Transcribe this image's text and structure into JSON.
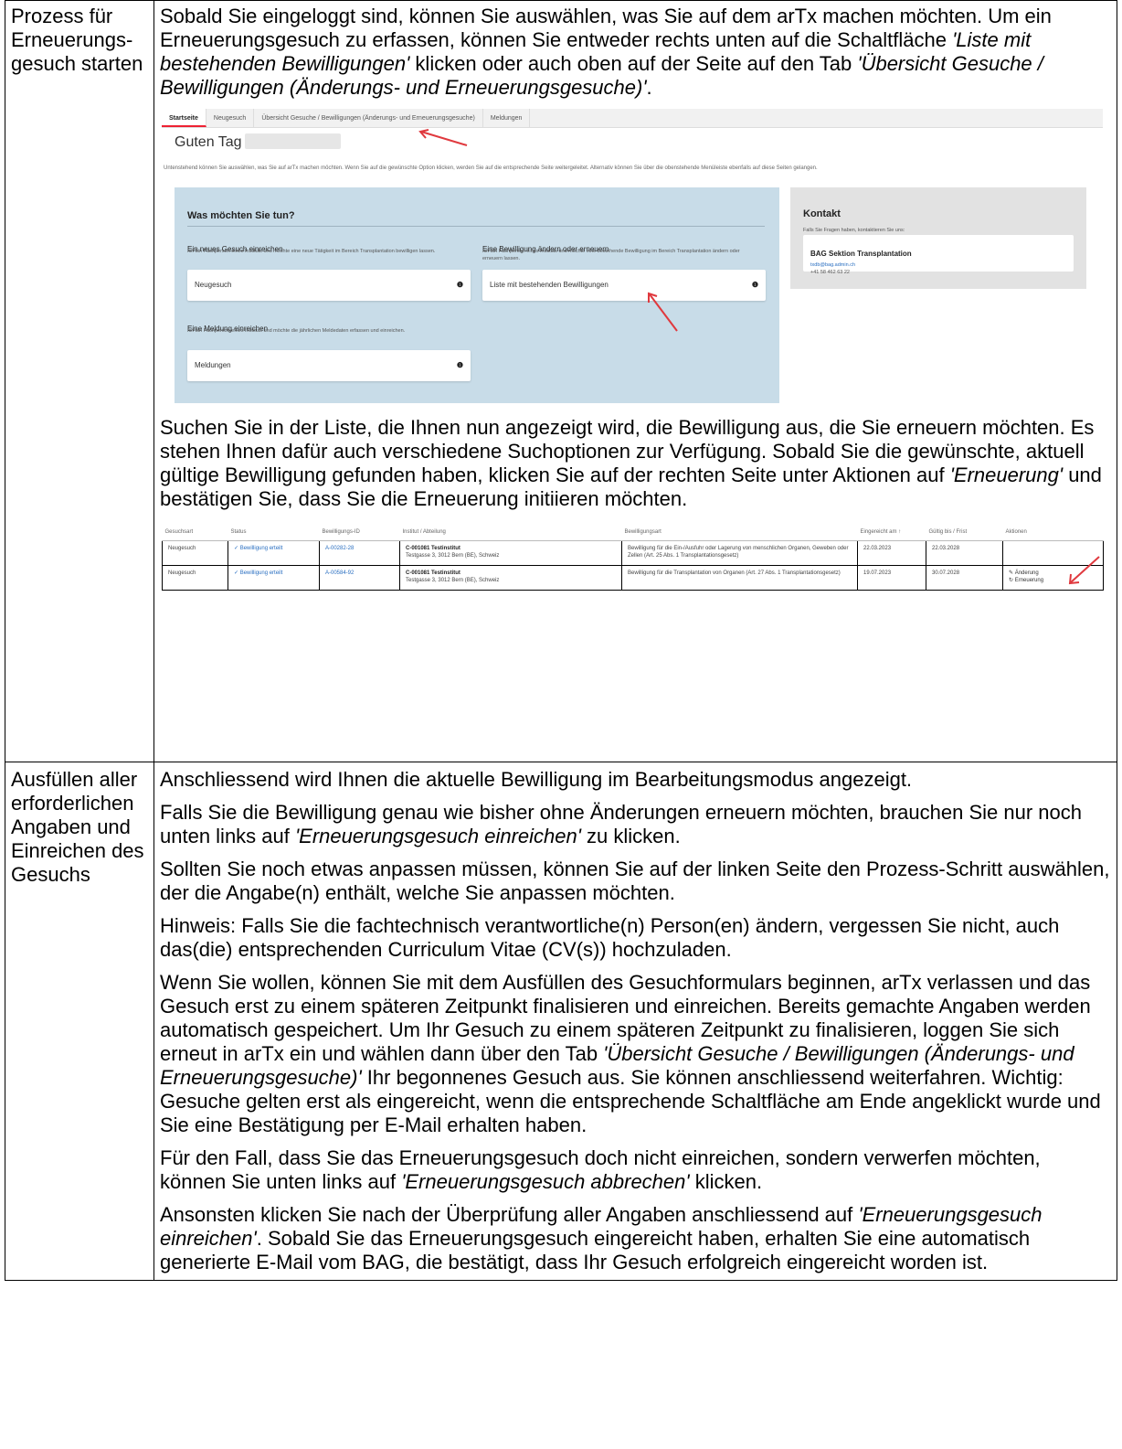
{
  "row1": {
    "label": "Prozess für Erneuerungs-gesuch starten",
    "p1_before": "Sobald Sie eingeloggt sind, können Sie auswählen, was Sie auf dem arTx machen möchten. Um ein Erneuerungsgesuch zu erfassen, können Sie entweder rechts unten auf die Schaltfläche ",
    "p1_em1": "'Liste mit bestehenden Bewilligungen'",
    "p1_mid": " klicken oder auch oben auf der Seite auf den Tab ",
    "p1_em2": "'Übersicht Gesuche / Bewilligungen (Änderungs- und Erneuerungsgesuche)'",
    "p1_after": ".",
    "p2_before": "Suchen Sie in der Liste, die Ihnen nun angezeigt wird, die Bewilligung aus, die Sie erneuern möchten. Es stehen Ihnen dafür auch verschiedene Suchoptionen zur Verfügung. Sobald Sie die gewünschte, aktuell gültige Bewilligung gefunden haben, klicken Sie auf der rechten Seite unter Aktionen auf ",
    "p2_em": "'Erneuerung'",
    "p2_after": " und bestätigen Sie, dass Sie die Erneuerung initiieren möchten."
  },
  "shot1": {
    "tabs": [
      "Startseite",
      "Neugesuch",
      "Übersicht Gesuche / Bewilligungen (Änderungs- und Erneuerungsgesuche)",
      "Meldungen"
    ],
    "greeting": "Guten Tag",
    "intro": "Untenstehend können Sie auswählen, was Sie auf arTx machen möchten. Wenn Sie auf die gewünschte Option klicken, werden Sie auf die entsprechende Seite weitergeleitet. Alternativ können Sie über die obenstehende Menüleiste ebenfalls auf diese Seiten gelangen.",
    "panel_title": "Was möchten Sie tun?",
    "opt1_title": "Ein neues Gesuch einreichen",
    "opt1_desc": "Ich bin Fachperson eines Instituts und möchte eine neue Tätigkeit im Bereich Transplantation bewilligen lassen.",
    "opt1_button": "Neugesuch",
    "opt2_title": "Eine Bewilligung ändern oder erneuern",
    "opt2_desc": "Ich bin Fachperson eines Instituts und möchte eine bestehende Bewilligung im Bereich Transplantation ändern oder erneuern lassen.",
    "opt2_button": "Liste mit bestehenden Bewilligungen",
    "opt3_title": "Eine Meldung einreichen",
    "opt3_desc": "Ich bin Fachperson eines Instituts und möchte die jährlichen Meldedaten erfassen und einreichen.",
    "opt3_button": "Meldungen",
    "info_glyph": "❶",
    "kontakt_title": "Kontakt",
    "kontakt_sub": "Falls Sie Fragen haben, kontaktieren Sie uns:",
    "kontakt_name": "BAG Sektion Transplantation",
    "kontakt_mail": "txdb@bag.admin.ch",
    "kontakt_tel": "+41 58 462 63 22"
  },
  "shot2": {
    "headers": [
      "Gesuchsart",
      "Status",
      "Bewilligungs-ID",
      "Institut / Abteilung",
      "Bewilligungsart",
      "Eingereicht am ↑",
      "Gültig bis / Frist",
      "Aktionen"
    ],
    "rows": [
      {
        "art": "Neugesuch",
        "status": "✓ Bewilligung erteilt",
        "id": "A-00282-28",
        "inst1": "C-001081 Testinstitut",
        "inst2": "Testgasse 3, 3012 Bern (BE), Schweiz",
        "bew": "Bewilligung für die Ein-/Ausfuhr oder Lagerung von menschlichen Organen, Geweben oder Zellen (Art. 25 Abs. 1 Transplantationsgesetz)",
        "eing": "22.03.2023",
        "gueltig": "22.03.2028",
        "act1": "",
        "act2": ""
      },
      {
        "art": "Neugesuch",
        "status": "✓ Bewilligung erteilt",
        "id": "A-00584-92",
        "inst1": "C-001081 Testinstitut",
        "inst2": "Testgasse 3, 3012 Bern (BE), Schweiz",
        "bew": "Bewilligung für die Transplantation von Organen (Art. 27 Abs. 1 Transplantationsgesetz)",
        "eing": "19.07.2023",
        "gueltig": "30.07.2028",
        "act1": "✎ Änderung",
        "act2": "↻ Erneuerung"
      }
    ]
  },
  "row2": {
    "label": "Ausfüllen aller erforderlichen Angaben und Einreichen des Gesuchs",
    "p1": "Anschliessend wird Ihnen die aktuelle Bewilligung im Bearbeitungsmodus angezeigt.",
    "p2_before": "Falls Sie die Bewilligung genau wie bisher ohne Änderungen erneuern möchten, brauchen Sie nur noch unten links auf ",
    "p2_em": "'Erneuerungsgesuch einreichen'",
    "p2_after": " zu klicken.",
    "p3": "Sollten Sie noch etwas anpassen müssen, können Sie auf der linken Seite den Prozess-Schritt auswählen, der die Angabe(n) enthält, welche Sie anpassen möchten.",
    "p4": "Hinweis: Falls Sie die fachtechnisch verantwortliche(n) Person(en) ändern, vergessen Sie nicht, auch das(die) entsprechenden Curriculum Vitae (CV(s)) hochzuladen.",
    "p5_before": "Wenn Sie wollen, können Sie mit dem Ausfüllen des Gesuchformulars beginnen, arTx verlassen und das Gesuch erst zu einem späteren Zeitpunkt finalisieren und einreichen. Bereits gemachte Angaben werden automatisch gespeichert. Um Ihr Gesuch zu einem späteren Zeitpunkt zu finalisieren, loggen Sie sich erneut in arTx ein und wählen dann über den Tab ",
    "p5_em": "'Übersicht Gesuche / Bewilligungen (Änderungs- und Erneuerungsgesuche)'",
    "p5_after": " Ihr begonnenes Gesuch aus. Sie können anschliessend weiterfahren. Wichtig: Gesuche gelten erst als eingereicht, wenn die entsprechende Schaltfläche am Ende angeklickt wurde und Sie eine Bestätigung per E-Mail erhalten haben.",
    "p6_before": "Für den Fall, dass Sie das Erneuerungsgesuch doch nicht einreichen, sondern verwerfen möchten, können Sie unten links auf ",
    "p6_em": "'Erneuerungsgesuch abbrechen'",
    "p6_after": " klicken.",
    "p7_before": "Ansonsten klicken Sie nach der Überprüfung aller Angaben anschliessend auf ",
    "p7_em": "'Erneuerungsgesuch einreichen'",
    "p7_after": ". Sobald Sie das Erneuerungsgesuch eingereicht haben, erhalten Sie eine automatisch generierte E-Mail vom BAG, die bestätigt, dass Ihr Gesuch erfolgreich eingereicht worden ist."
  },
  "colors": {
    "arrow": "#e0393e",
    "panel": "#c8dce8",
    "kontakt_bg": "#e2e2e2",
    "link": "#2a6fc1"
  }
}
